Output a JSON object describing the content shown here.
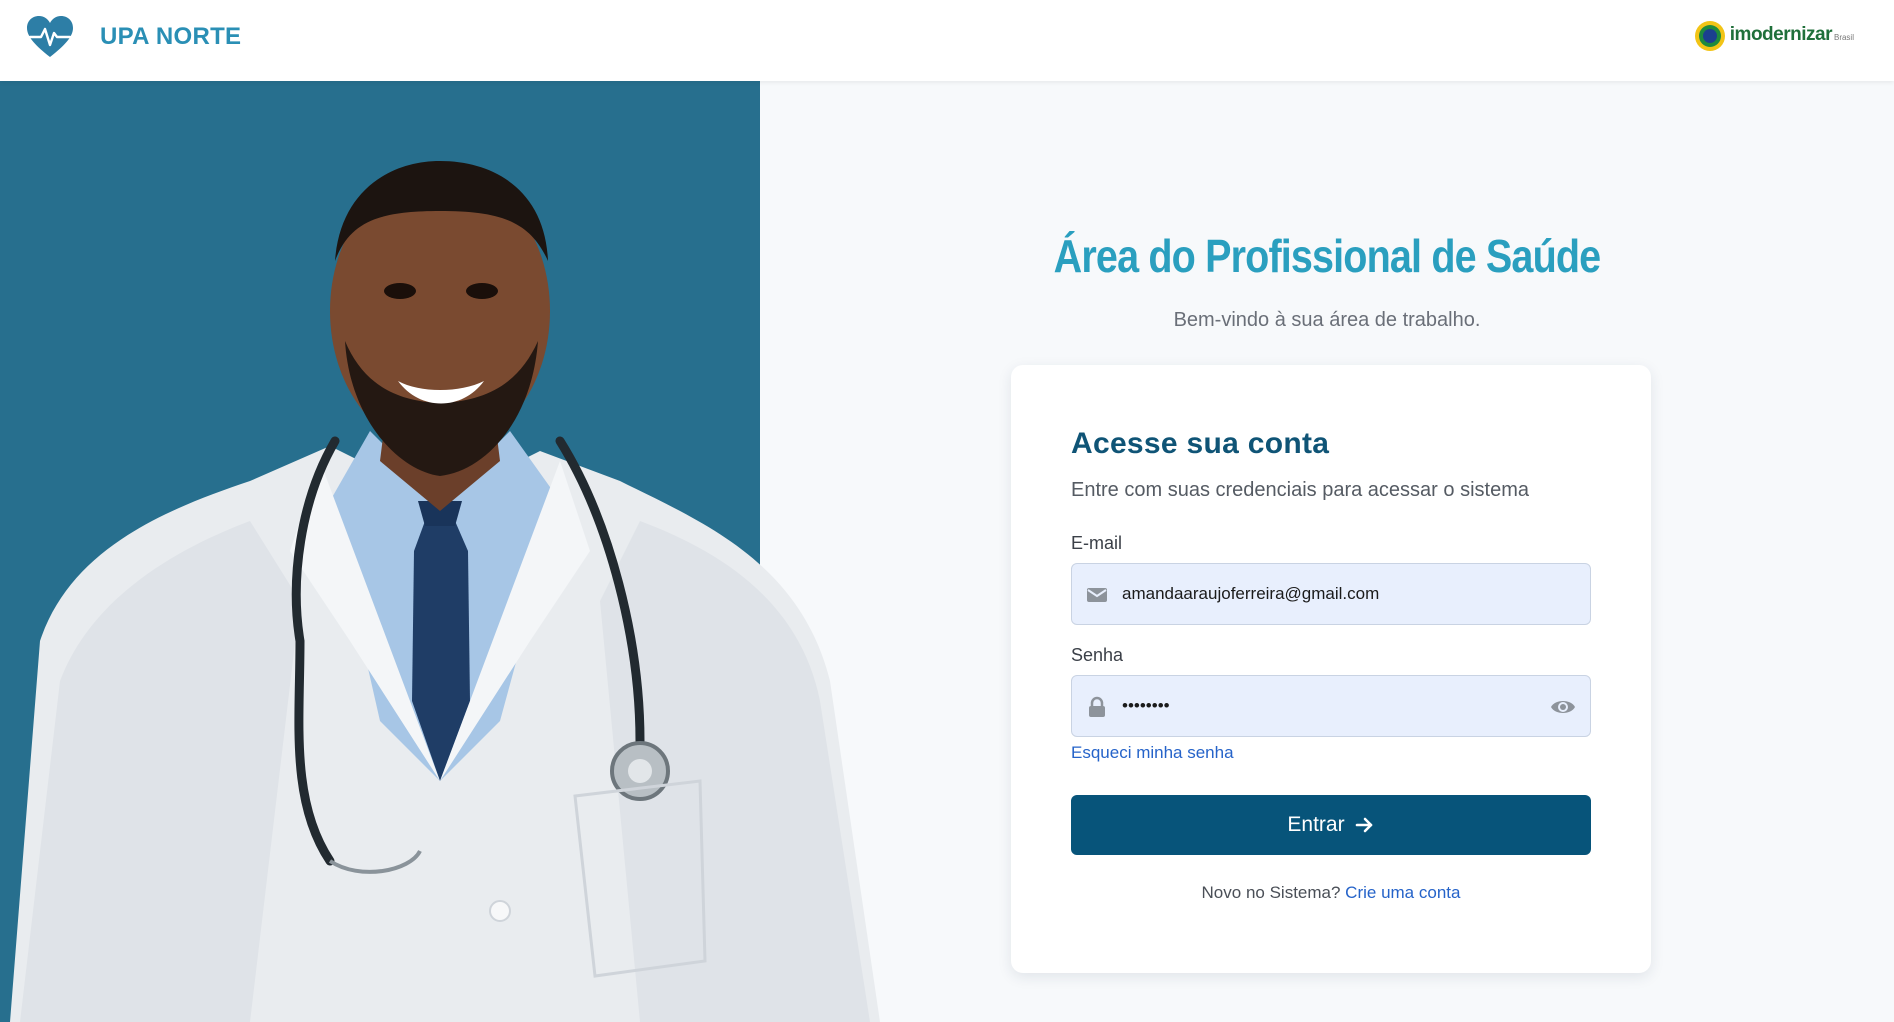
{
  "header": {
    "brand_name": "UPA NORTE",
    "partner_name": "imodernizar",
    "partner_suffix": "Brasil"
  },
  "main": {
    "title": "Área do Profissional de Saúde",
    "subtitle": "Bem-vindo à sua área de trabalho."
  },
  "login": {
    "title": "Acesse sua conta",
    "description": "Entre com suas credenciais para acessar o sistema",
    "email_label": "E-mail",
    "email_value": "amandaaraujoferreira@gmail.com",
    "password_label": "Senha",
    "password_value": "••••••••",
    "forgot_label": "Esqueci minha senha",
    "submit_label": "Entrar",
    "signup_prompt": "Novo no Sistema?",
    "signup_link": "Crie uma conta"
  },
  "icons": {
    "brand": "heart-pulse-icon",
    "email": "envelope-icon",
    "password": "lock-icon",
    "toggle": "eye-icon",
    "submit": "arrow-right-icon"
  },
  "colors": {
    "brand": "#2a8fb5",
    "hero_bg": "#276f8e",
    "title": "#2a9fbf",
    "primary_button": "#07547a",
    "link": "#2563c9",
    "input_bg": "#e8effd"
  }
}
